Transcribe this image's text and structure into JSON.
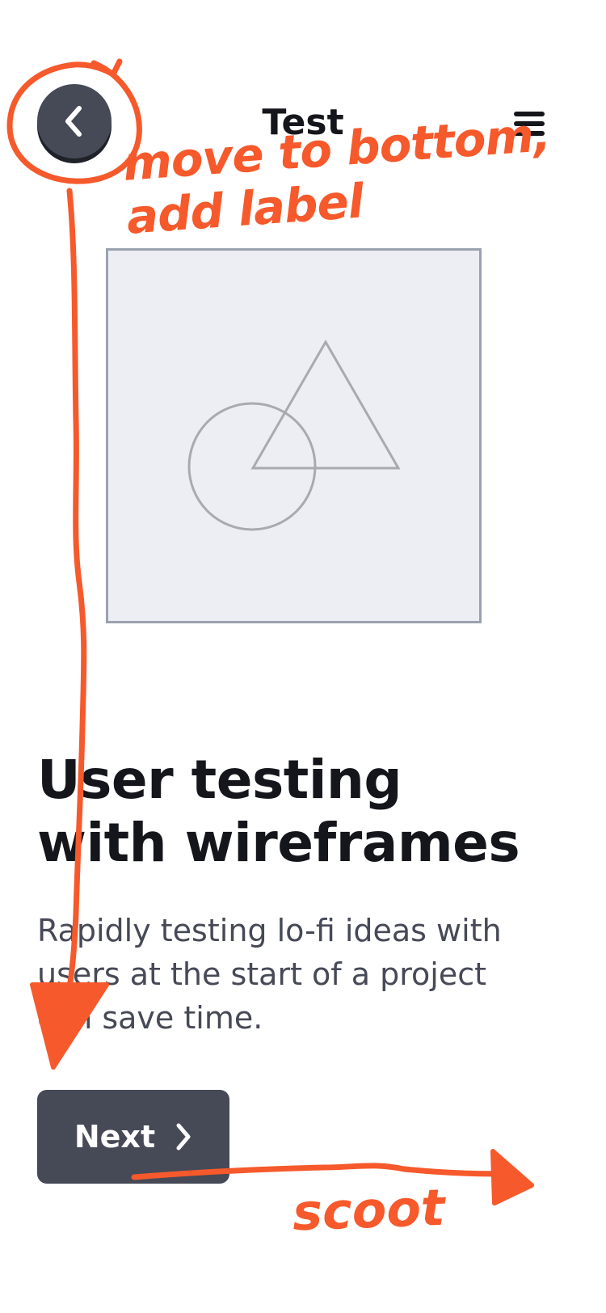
{
  "header": {
    "title": "Test",
    "back_icon": "chevron-left-icon",
    "menu_icon": "hamburger-menu-icon"
  },
  "hero": {
    "image": "image-placeholder",
    "headline_lines": [
      "User testing",
      "with wireframes"
    ],
    "body_lines": [
      "Rapidly testing lo-fi ideas with",
      "users at the start of a project",
      "can save time."
    ]
  },
  "actions": {
    "next_label": "Next",
    "next_icon": "chevron-right-icon"
  },
  "annotations": {
    "note_move_lines": [
      "move to bottom,",
      "add label"
    ],
    "note_scoot": "scoot",
    "color": "#f6592b"
  },
  "colors": {
    "primary_dark": "#464956",
    "text_dark": "#15161b",
    "placeholder_fill": "#eceef4",
    "placeholder_border": "#9aa2b0"
  }
}
